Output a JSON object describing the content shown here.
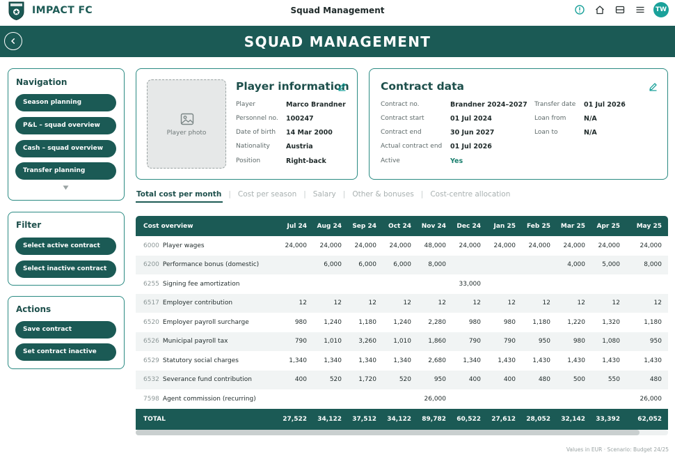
{
  "app": {
    "brand": "IMPACT FC",
    "logo_text": "IMPACT FC",
    "page_title": "Squad Management",
    "banner_title": "SQUAD MANAGEMENT",
    "user_initials": "TW"
  },
  "colors": {
    "primary": "#1b5a55",
    "accent": "#1aa19a",
    "border": "#2a8a82",
    "active_value": "#1a7f6e"
  },
  "icons": {
    "top": [
      "info-icon",
      "home-icon",
      "panel-icon",
      "menu-icon"
    ],
    "back": "back-arrow-icon",
    "edit": "pencil-icon",
    "photo": "image-icon",
    "more": "chevron-down-icon"
  },
  "navigation": {
    "heading": "Navigation",
    "items": [
      {
        "label": "Season planning"
      },
      {
        "label": "P&L – squad overview"
      },
      {
        "label": "Cash – squad overview"
      },
      {
        "label": "Transfer planning"
      }
    ]
  },
  "filter": {
    "heading": "Filter",
    "items": [
      {
        "label": "Select active contract"
      },
      {
        "label": "Select inactive contract"
      }
    ]
  },
  "actions": {
    "heading": "Actions",
    "items": [
      {
        "label": "Save contract"
      },
      {
        "label": "Set contract inactive"
      }
    ]
  },
  "player": {
    "title": "Player information",
    "photo_label": "Player photo",
    "fields": [
      {
        "label": "Player",
        "value": "Marco Brandner"
      },
      {
        "label": "Personnel no.",
        "value": "100247"
      },
      {
        "label": "Date of birth",
        "value": "14 Mar 2000"
      },
      {
        "label": "Nationality",
        "value": "Austria"
      },
      {
        "label": "Position",
        "value": "Right-back"
      }
    ]
  },
  "contract": {
    "title": "Contract data",
    "left": [
      {
        "label": "Contract no.",
        "value": "Brandner 2024–2027"
      },
      {
        "label": "Contract start",
        "value": "01 Jul 2024"
      },
      {
        "label": "Contract end",
        "value": "30 Jun 2027"
      },
      {
        "label": "Actual contract end",
        "value": "01 Jul 2026"
      },
      {
        "label": "Active",
        "value": "Yes"
      }
    ],
    "right": [
      {
        "label": "Transfer date",
        "value": "01 Jul 2026"
      },
      {
        "label": "Loan from",
        "value": "N/A"
      },
      {
        "label": "Loan to",
        "value": "N/A"
      }
    ]
  },
  "tabs": [
    {
      "label": "Total cost per month",
      "active": true
    },
    {
      "label": "Cost per season"
    },
    {
      "label": "Salary"
    },
    {
      "label": "Other & bonuses"
    },
    {
      "label": "Cost-centre allocation"
    }
  ],
  "table": {
    "header": "Cost overview",
    "months": [
      "Jul 24",
      "Aug 24",
      "Sep 24",
      "Oct 24",
      "Nov 24",
      "Dec 24",
      "Jan 25",
      "Feb 25",
      "Mar 25",
      "Apr 25",
      "May 25"
    ],
    "rows": [
      {
        "code": "6000",
        "name": "Player wages",
        "values": [
          "24,000",
          "24,000",
          "24,000",
          "24,000",
          "48,000",
          "24,000",
          "24,000",
          "24,000",
          "24,000",
          "24,000",
          "24,000"
        ]
      },
      {
        "code": "6200",
        "name": "Performance bonus (domestic)",
        "values": [
          "",
          "6,000",
          "6,000",
          "6,000",
          "8,000",
          "",
          "",
          "",
          "4,000",
          "5,000",
          "8,000"
        ]
      },
      {
        "code": "6255",
        "name": "Signing fee amortization",
        "values": [
          "",
          "",
          "",
          "",
          "",
          "33,000",
          "",
          "",
          "",
          "",
          ""
        ]
      },
      {
        "code": "6517",
        "name": "Employer contribution",
        "values": [
          "12",
          "12",
          "12",
          "12",
          "12",
          "12",
          "12",
          "12",
          "12",
          "12",
          "12"
        ]
      },
      {
        "code": "6520",
        "name": "Employer payroll surcharge",
        "values": [
          "980",
          "1,240",
          "1,180",
          "1,240",
          "2,280",
          "980",
          "980",
          "1,180",
          "1,220",
          "1,320",
          "1,180"
        ]
      },
      {
        "code": "6526",
        "name": "Municipal payroll tax",
        "values": [
          "790",
          "1,010",
          "3,260",
          "1,010",
          "1,860",
          "790",
          "790",
          "950",
          "980",
          "1,080",
          "950"
        ]
      },
      {
        "code": "6529",
        "name": "Statutory social charges",
        "values": [
          "1,340",
          "1,340",
          "1,340",
          "1,340",
          "2,680",
          "1,340",
          "1,430",
          "1,430",
          "1,430",
          "1,430",
          "1,430"
        ]
      },
      {
        "code": "6532",
        "name": "Severance fund contribution",
        "values": [
          "400",
          "520",
          "1,720",
          "520",
          "950",
          "400",
          "400",
          "480",
          "500",
          "550",
          "480"
        ]
      },
      {
        "code": "7598",
        "name": "Agent commission (recurring)",
        "values": [
          "",
          "",
          "",
          "",
          "26,000",
          "",
          "",
          "",
          "",
          "",
          "26,000"
        ]
      }
    ],
    "total": {
      "label": "TOTAL",
      "values": [
        "27,522",
        "34,122",
        "37,512",
        "34,122",
        "89,782",
        "60,522",
        "27,612",
        "28,052",
        "32,142",
        "33,392",
        "62,052"
      ]
    }
  },
  "footnote": "Values in EUR · Scenario: Budget 24/25"
}
